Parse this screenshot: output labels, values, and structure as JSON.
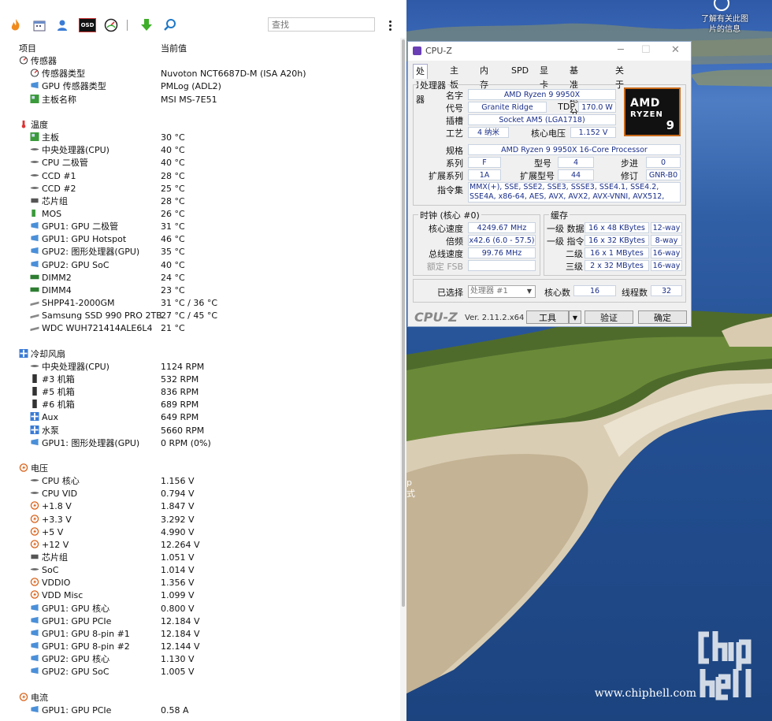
{
  "toolbar": {
    "search_placeholder": "查找",
    "osd_label": "OSD",
    "icons": [
      "flame-icon",
      "calendar-icon",
      "user-icon",
      "osd-icon",
      "gauge-icon",
      "download-icon",
      "search-icon"
    ]
  },
  "sensor_table": {
    "col_item": "项目",
    "col_value": "当前值",
    "groups": [
      {
        "title": "传感器",
        "rows": [
          {
            "label": "传感器类型",
            "value": "Nuvoton NCT6687D-M  (ISA A20h)"
          },
          {
            "label": "GPU 传感器类型",
            "value": "PMLog  (ADL2)"
          },
          {
            "label": "主板名称",
            "value": "MSI MS-7E51"
          }
        ]
      },
      {
        "title": "温度",
        "rows": [
          {
            "label": "主板",
            "value": "30 °C"
          },
          {
            "label": "中央处理器(CPU)",
            "value": "40 °C"
          },
          {
            "label": "CPU 二极管",
            "value": "40 °C"
          },
          {
            "label": "CCD #1",
            "value": "28 °C"
          },
          {
            "label": "CCD #2",
            "value": "25 °C"
          },
          {
            "label": "芯片组",
            "value": "28 °C"
          },
          {
            "label": "MOS",
            "value": "26 °C"
          },
          {
            "label": "GPU1: GPU 二极管",
            "value": "31 °C"
          },
          {
            "label": "GPU1: GPU Hotspot",
            "value": "46 °C"
          },
          {
            "label": "GPU2: 图形处理器(GPU)",
            "value": "35 °C"
          },
          {
            "label": "GPU2: GPU SoC",
            "value": "40 °C"
          },
          {
            "label": "DIMM2",
            "value": "24 °C"
          },
          {
            "label": "DIMM4",
            "value": "23 °C"
          },
          {
            "label": "SHPP41-2000GM",
            "value": "31 °C / 36 °C"
          },
          {
            "label": "Samsung SSD 990 PRO 2TB",
            "value": "27 °C / 45 °C"
          },
          {
            "label": "WDC  WUH721414ALE6L4",
            "value": "21 °C"
          }
        ]
      },
      {
        "title": "冷却风扇",
        "rows": [
          {
            "label": "中央处理器(CPU)",
            "value": "1124 RPM"
          },
          {
            "label": "#3 机箱",
            "value": "532 RPM"
          },
          {
            "label": "#5 机箱",
            "value": "836 RPM"
          },
          {
            "label": "#6 机箱",
            "value": "689 RPM"
          },
          {
            "label": "Aux",
            "value": "649 RPM"
          },
          {
            "label": "水泵",
            "value": "5660 RPM"
          },
          {
            "label": "GPU1: 图形处理器(GPU)",
            "value": "0 RPM  (0%)"
          }
        ]
      },
      {
        "title": "电压",
        "rows": [
          {
            "label": "CPU 核心",
            "value": "1.156 V"
          },
          {
            "label": "CPU VID",
            "value": "0.794 V"
          },
          {
            "label": "+1.8 V",
            "value": "1.847 V"
          },
          {
            "label": "+3.3 V",
            "value": "3.292 V"
          },
          {
            "label": "+5 V",
            "value": "4.990 V"
          },
          {
            "label": "+12 V",
            "value": "12.264 V"
          },
          {
            "label": "芯片组",
            "value": "1.051 V"
          },
          {
            "label": "SoC",
            "value": "1.014 V"
          },
          {
            "label": "VDDIO",
            "value": "1.356 V"
          },
          {
            "label": "VDD Misc",
            "value": "1.099 V"
          },
          {
            "label": "GPU1: GPU 核心",
            "value": "0.800 V"
          },
          {
            "label": "GPU1: GPU PCIe",
            "value": "12.184 V"
          },
          {
            "label": "GPU1: GPU 8-pin #1",
            "value": "12.184 V"
          },
          {
            "label": "GPU1: GPU 8-pin #2",
            "value": "12.144 V"
          },
          {
            "label": "GPU2: GPU 核心",
            "value": "1.130 V"
          },
          {
            "label": "GPU2: GPU SoC",
            "value": "1.005 V"
          }
        ]
      },
      {
        "title": "电流",
        "rows": [
          {
            "label": "GPU1: GPU PCIe",
            "value": "0.58 A"
          }
        ]
      }
    ]
  },
  "cpuz": {
    "title": "CPU-Z",
    "tabs": [
      "处理器",
      "主板",
      "内存",
      "SPD",
      "显卡",
      "基准跑分",
      "关于"
    ],
    "active_tab": "处理器",
    "processor_group": "处理器",
    "name_label": "名字",
    "name": "AMD Ryzen 9 9950X",
    "codename_label": "代号",
    "codename": "Granite Ridge",
    "tdp_label": "TDP",
    "tdp": "170.0 W",
    "socket_label": "插槽",
    "socket": "Socket AM5 (LGA1718)",
    "process_label": "工艺",
    "process": "4 纳米",
    "voltage_label": "核心电压",
    "voltage": "1.152 V",
    "spec_label": "规格",
    "spec": "AMD Ryzen 9 9950X 16-Core Processor",
    "family_label": "系列",
    "family": "F",
    "model_label": "型号",
    "model": "4",
    "stepping_label": "步进",
    "stepping": "0",
    "ext_family_label": "扩展系列",
    "ext_family": "1A",
    "ext_model_label": "扩展型号",
    "ext_model": "44",
    "revision_label": "修订",
    "revision": "GNR-B0",
    "instructions_label": "指令集",
    "instructions": "MMX(+), SSE, SSE2, SSE3, SSSE3, SSE4.1, SSE4.2, SSE4A, x86-64, AES, AVX, AVX2, AVX-VNNI, AVX512, FMA3, SHA",
    "logo": {
      "brand": "AMD",
      "line": "RYZEN",
      "tier": "9"
    },
    "clocks_group": "时钟 (核心 #0)",
    "core_speed_label": "核心速度",
    "core_speed": "4249.67 MHz",
    "multiplier_label": "倍频",
    "multiplier": "x42.6 (6.0 - 57.5)",
    "bus_speed_label": "总线速度",
    "bus_speed": "99.76 MHz",
    "rated_fsb_label": "额定 FSB",
    "rated_fsb": "",
    "cache_group": "缓存",
    "l1d_label": "一级 数据",
    "l1d": "16 x 48 KBytes",
    "l1d_way": "12-way",
    "l1i_label": "一级 指令",
    "l1i": "16 x 32 KBytes",
    "l1i_way": "8-way",
    "l2_label": "二级",
    "l2": "16 x 1 MBytes",
    "l2_way": "16-way",
    "l3_label": "三级",
    "l3": "2 x 32 MBytes",
    "l3_way": "16-way",
    "selection_label": "已选择",
    "selection": "处理器 #1",
    "cores_label": "核心数",
    "cores": "16",
    "threads_label": "线程数",
    "threads": "32",
    "brand": "CPU-Z",
    "version": "Ver. 2.11.2.x64",
    "tools_btn": "工具",
    "validate_btn": "验证",
    "ok_btn": "确定"
  },
  "desktop": {
    "tooltip_text_line1": "了解有关此图",
    "tooltip_text_line2": "片的信息",
    "watermark": "www.chiphell.com",
    "logo_text": "chip hell",
    "partial_text_1": "p",
    "partial_text_2": "式"
  }
}
